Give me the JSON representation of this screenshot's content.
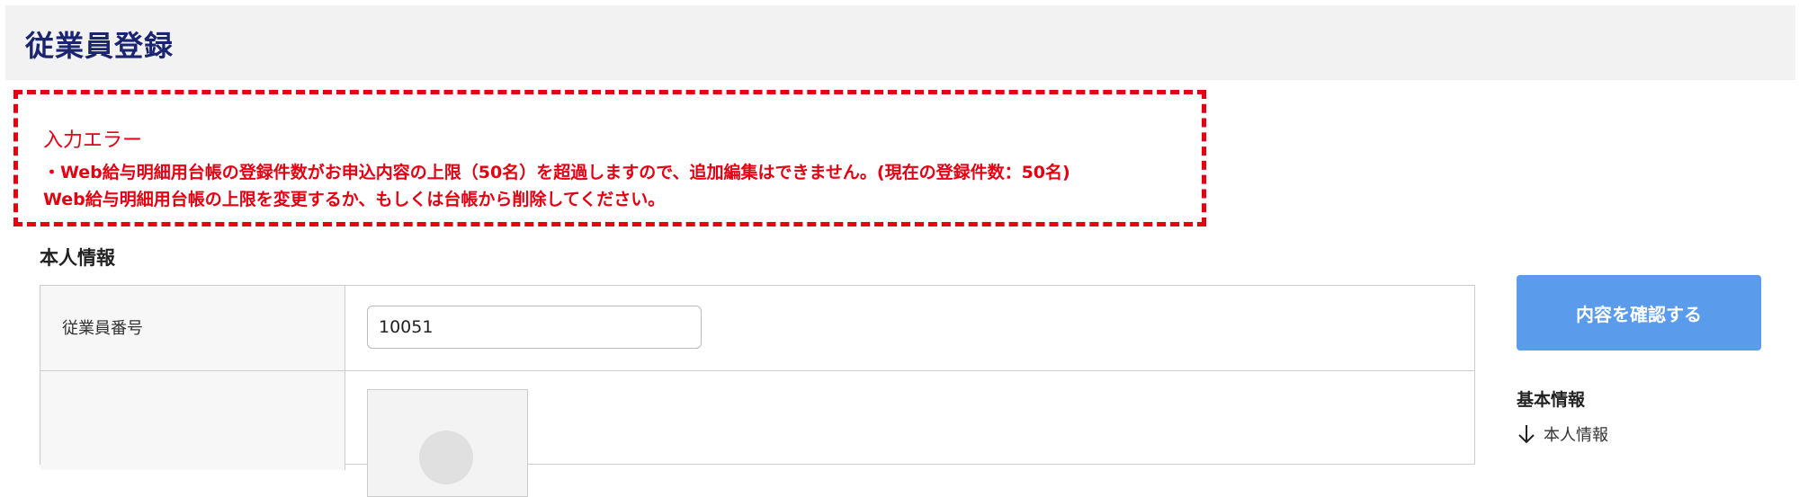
{
  "header": {
    "title": "従業員登録"
  },
  "error": {
    "title": "入力エラー",
    "lines": [
      "・Web給与明細用台帳の登録件数がお申込内容の上限（50名）を超過しますので、追加編集はできません。(現在の登録件数：50名)",
      "Web給与明細用台帳の上限を変更するか、もしくは台帳から削除してください。"
    ],
    "color": "#e60012"
  },
  "section": {
    "title": "本人情報"
  },
  "form": {
    "employee_number_label": "従業員番号",
    "employee_number_value": "10051"
  },
  "sidebar": {
    "confirm_label": "内容を確認する",
    "heading": "基本情報",
    "links": [
      {
        "label": "本人情報",
        "icon": "arrow-down-icon"
      }
    ]
  },
  "colors": {
    "title": "#1a2470",
    "accent_button": "#5b9bec",
    "error": "#e60012"
  }
}
